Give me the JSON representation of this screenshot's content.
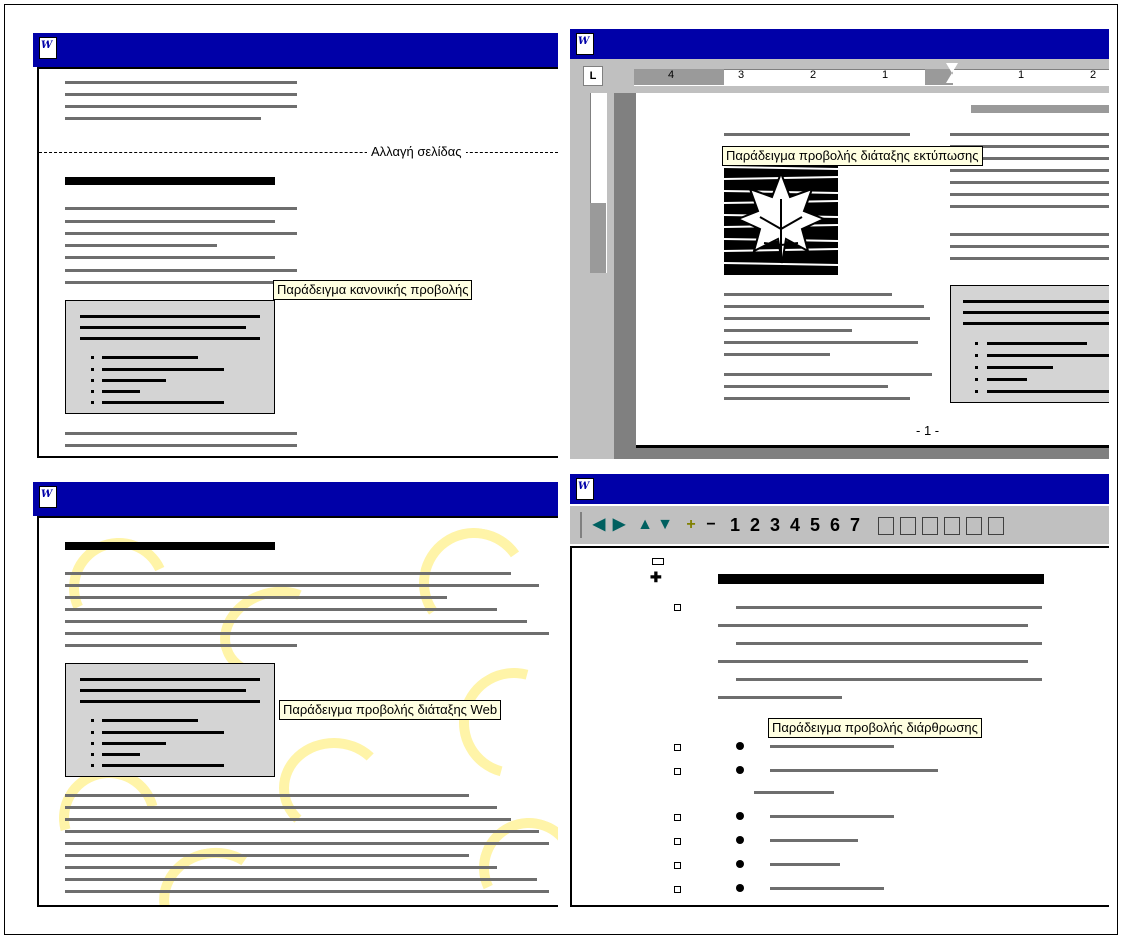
{
  "captions": {
    "normal_view": "Παράδειγμα κανονικής προβολής",
    "page_break": "Αλλαγή σελίδας",
    "print_layout": "Παράδειγμα προβολής διάταξης εκτύπωσης",
    "web_layout": "Παράδειγμα προβολής διάταξης Web",
    "outline": "Παράδειγμα προβολής διάρθρωσης"
  },
  "print_layout_page_number": "- 1 -",
  "ruler": {
    "labels": [
      "4",
      "3",
      "2",
      "1",
      "1",
      "2"
    ]
  },
  "outline_toolbar": {
    "levels": [
      "1",
      "2",
      "3",
      "4",
      "5",
      "6",
      "7"
    ]
  },
  "colors": {
    "titlebar": "#0000a8",
    "box": "#d4d4d4",
    "caption_bg": "#ffffe1",
    "ruler": "#c0c0c0"
  },
  "icons": [
    "word-app-icon",
    "left-arrow-icon",
    "right-arrow-icon",
    "up-arrow-icon",
    "down-arrow-icon",
    "plus-icon",
    "minus-icon",
    "maple-leaf-clipart"
  ]
}
